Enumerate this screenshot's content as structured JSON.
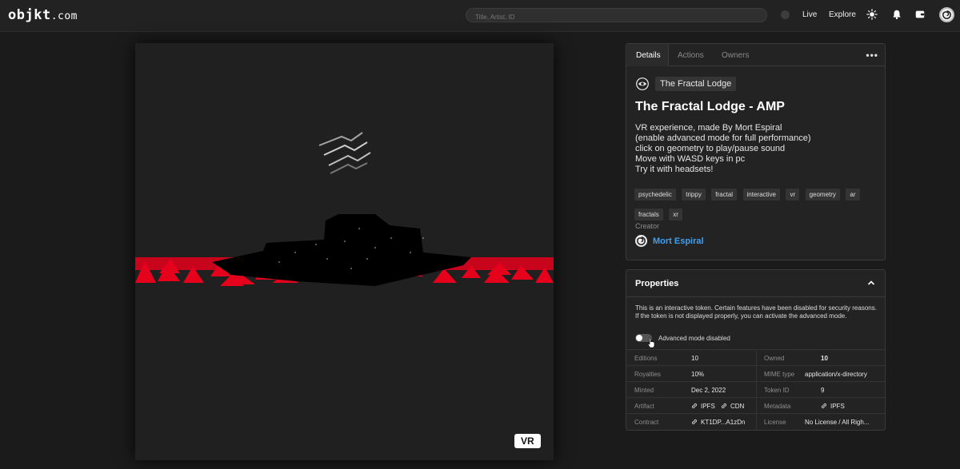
{
  "header": {
    "logo_main": "objkt",
    "logo_suffix": ".com",
    "search_placeholder": "Title, Artist, ID",
    "nav_live": "Live",
    "nav_explore": "Explore",
    "icons": [
      "sun-icon",
      "bell-icon",
      "wallet-icon",
      "avatar"
    ]
  },
  "artwork": {
    "badge": "VR",
    "colors": {
      "red": "#e5001b",
      "black": "#000000",
      "bg": "#202020"
    }
  },
  "details": {
    "tabs": [
      "Details",
      "Actions",
      "Owners"
    ],
    "active_tab": "Details",
    "more": "•••",
    "collection": "The Fractal Lodge",
    "title": "The Fractal Lodge - AMP",
    "description": [
      "VR experience, made By Mort Espiral",
      "(enable advanced mode for full performance)",
      "click on geometry to play/pause sound",
      "Move with WASD keys in pc",
      "Try it with headsets!"
    ],
    "tags": [
      "psychedelic",
      "trippy",
      "fractal",
      "interactive",
      "vr",
      "geometry",
      "ar",
      "fractals",
      "xr"
    ],
    "creator_label": "Creator",
    "creator_name": "Mort Espiral",
    "accent": "#3ea0f5"
  },
  "properties": {
    "title": "Properties",
    "note": "This is an interactive token. Certain features have been disabled for security reasons. If the token is not displayed properly, you can activate the advanced mode.",
    "toggle_label": "Advanced mode disabled",
    "rows": [
      {
        "k1": "Editions",
        "v1": "10",
        "k2": "Owned",
        "v2": "10"
      },
      {
        "k1": "Royalties",
        "v1": "10%",
        "k2": "MIME type",
        "v2": "application/x-directory"
      },
      {
        "k1": "Minted",
        "v1": "Dec 2, 2022",
        "k2": "Token ID",
        "v2": "9"
      },
      {
        "k1": "Artifact",
        "v1a": "IPFS",
        "v1b": "CDN",
        "k2": "Metadata",
        "v2": "IPFS"
      },
      {
        "k1": "Contract",
        "v1": "KT1DP...A1zDn",
        "k2": "License",
        "v2": "No License / All Righ..."
      }
    ]
  }
}
